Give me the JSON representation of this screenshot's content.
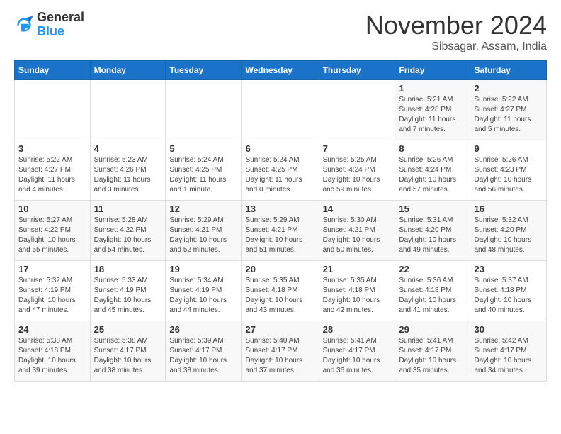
{
  "header": {
    "logo_general": "General",
    "logo_blue": "Blue",
    "month_title": "November 2024",
    "location": "Sibsagar, Assam, India"
  },
  "days_of_week": [
    "Sunday",
    "Monday",
    "Tuesday",
    "Wednesday",
    "Thursday",
    "Friday",
    "Saturday"
  ],
  "weeks": [
    [
      {
        "day": "",
        "info": ""
      },
      {
        "day": "",
        "info": ""
      },
      {
        "day": "",
        "info": ""
      },
      {
        "day": "",
        "info": ""
      },
      {
        "day": "",
        "info": ""
      },
      {
        "day": "1",
        "info": "Sunrise: 5:21 AM\nSunset: 4:28 PM\nDaylight: 11 hours and 7 minutes."
      },
      {
        "day": "2",
        "info": "Sunrise: 5:22 AM\nSunset: 4:27 PM\nDaylight: 11 hours and 5 minutes."
      }
    ],
    [
      {
        "day": "3",
        "info": "Sunrise: 5:22 AM\nSunset: 4:27 PM\nDaylight: 11 hours and 4 minutes."
      },
      {
        "day": "4",
        "info": "Sunrise: 5:23 AM\nSunset: 4:26 PM\nDaylight: 11 hours and 3 minutes."
      },
      {
        "day": "5",
        "info": "Sunrise: 5:24 AM\nSunset: 4:25 PM\nDaylight: 11 hours and 1 minute."
      },
      {
        "day": "6",
        "info": "Sunrise: 5:24 AM\nSunset: 4:25 PM\nDaylight: 11 hours and 0 minutes."
      },
      {
        "day": "7",
        "info": "Sunrise: 5:25 AM\nSunset: 4:24 PM\nDaylight: 10 hours and 59 minutes."
      },
      {
        "day": "8",
        "info": "Sunrise: 5:26 AM\nSunset: 4:24 PM\nDaylight: 10 hours and 57 minutes."
      },
      {
        "day": "9",
        "info": "Sunrise: 5:26 AM\nSunset: 4:23 PM\nDaylight: 10 hours and 56 minutes."
      }
    ],
    [
      {
        "day": "10",
        "info": "Sunrise: 5:27 AM\nSunset: 4:22 PM\nDaylight: 10 hours and 55 minutes."
      },
      {
        "day": "11",
        "info": "Sunrise: 5:28 AM\nSunset: 4:22 PM\nDaylight: 10 hours and 54 minutes."
      },
      {
        "day": "12",
        "info": "Sunrise: 5:29 AM\nSunset: 4:21 PM\nDaylight: 10 hours and 52 minutes."
      },
      {
        "day": "13",
        "info": "Sunrise: 5:29 AM\nSunset: 4:21 PM\nDaylight: 10 hours and 51 minutes."
      },
      {
        "day": "14",
        "info": "Sunrise: 5:30 AM\nSunset: 4:21 PM\nDaylight: 10 hours and 50 minutes."
      },
      {
        "day": "15",
        "info": "Sunrise: 5:31 AM\nSunset: 4:20 PM\nDaylight: 10 hours and 49 minutes."
      },
      {
        "day": "16",
        "info": "Sunrise: 5:32 AM\nSunset: 4:20 PM\nDaylight: 10 hours and 48 minutes."
      }
    ],
    [
      {
        "day": "17",
        "info": "Sunrise: 5:32 AM\nSunset: 4:19 PM\nDaylight: 10 hours and 47 minutes."
      },
      {
        "day": "18",
        "info": "Sunrise: 5:33 AM\nSunset: 4:19 PM\nDaylight: 10 hours and 45 minutes."
      },
      {
        "day": "19",
        "info": "Sunrise: 5:34 AM\nSunset: 4:19 PM\nDaylight: 10 hours and 44 minutes."
      },
      {
        "day": "20",
        "info": "Sunrise: 5:35 AM\nSunset: 4:18 PM\nDaylight: 10 hours and 43 minutes."
      },
      {
        "day": "21",
        "info": "Sunrise: 5:35 AM\nSunset: 4:18 PM\nDaylight: 10 hours and 42 minutes."
      },
      {
        "day": "22",
        "info": "Sunrise: 5:36 AM\nSunset: 4:18 PM\nDaylight: 10 hours and 41 minutes."
      },
      {
        "day": "23",
        "info": "Sunrise: 5:37 AM\nSunset: 4:18 PM\nDaylight: 10 hours and 40 minutes."
      }
    ],
    [
      {
        "day": "24",
        "info": "Sunrise: 5:38 AM\nSunset: 4:18 PM\nDaylight: 10 hours and 39 minutes."
      },
      {
        "day": "25",
        "info": "Sunrise: 5:38 AM\nSunset: 4:17 PM\nDaylight: 10 hours and 38 minutes."
      },
      {
        "day": "26",
        "info": "Sunrise: 5:39 AM\nSunset: 4:17 PM\nDaylight: 10 hours and 38 minutes."
      },
      {
        "day": "27",
        "info": "Sunrise: 5:40 AM\nSunset: 4:17 PM\nDaylight: 10 hours and 37 minutes."
      },
      {
        "day": "28",
        "info": "Sunrise: 5:41 AM\nSunset: 4:17 PM\nDaylight: 10 hours and 36 minutes."
      },
      {
        "day": "29",
        "info": "Sunrise: 5:41 AM\nSunset: 4:17 PM\nDaylight: 10 hours and 35 minutes."
      },
      {
        "day": "30",
        "info": "Sunrise: 5:42 AM\nSunset: 4:17 PM\nDaylight: 10 hours and 34 minutes."
      }
    ]
  ]
}
